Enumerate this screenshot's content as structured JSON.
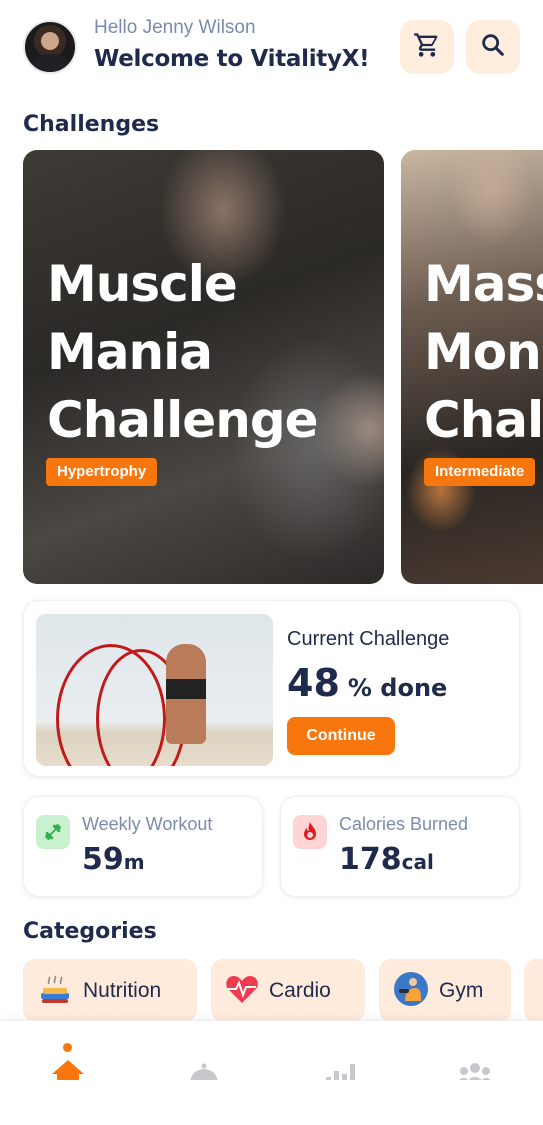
{
  "header": {
    "greeting": "Hello Jenny Wilson",
    "welcome": "Welcome to VitalityX!",
    "cart_icon": "cart-icon",
    "search_icon": "search-icon"
  },
  "challenges": {
    "title": "Challenges",
    "cards": [
      {
        "title": "Muscle Mania Challenge",
        "line1": "Muscle",
        "line2": "Mania",
        "line3": "Challenge",
        "tag": "Hypertrophy"
      },
      {
        "title": "Mass Monster Challenge",
        "line1": "Mass",
        "line2": "Mons",
        "line3": "Chal",
        "tag": "Intermediate"
      }
    ]
  },
  "current_challenge": {
    "label": "Current Challenge",
    "progress_value": "48",
    "progress_unit": "% done",
    "progress_fraction": 0.48,
    "button": "Continue"
  },
  "stats": {
    "weekly": {
      "label": "Weekly Workout",
      "value": "59",
      "unit": "m",
      "icon": "dumbbell-icon"
    },
    "calories": {
      "label": "Calories Burned",
      "value": "178",
      "unit": "cal",
      "icon": "flame-icon"
    }
  },
  "categories": {
    "title": "Categories",
    "items": [
      {
        "label": "Nutrition",
        "icon": "food-icon"
      },
      {
        "label": "Cardio",
        "icon": "heart-icon"
      },
      {
        "label": "Gym",
        "icon": "gym-icon"
      }
    ]
  },
  "nav": {
    "items": [
      "home-icon",
      "dining-icon",
      "stats-icon",
      "community-icon"
    ],
    "active": "home-icon"
  },
  "colors": {
    "accent": "#f7760d",
    "accent_soft": "#ffeedd",
    "text_dark": "#1f2a4d",
    "text_muted": "#7b8bb0"
  }
}
